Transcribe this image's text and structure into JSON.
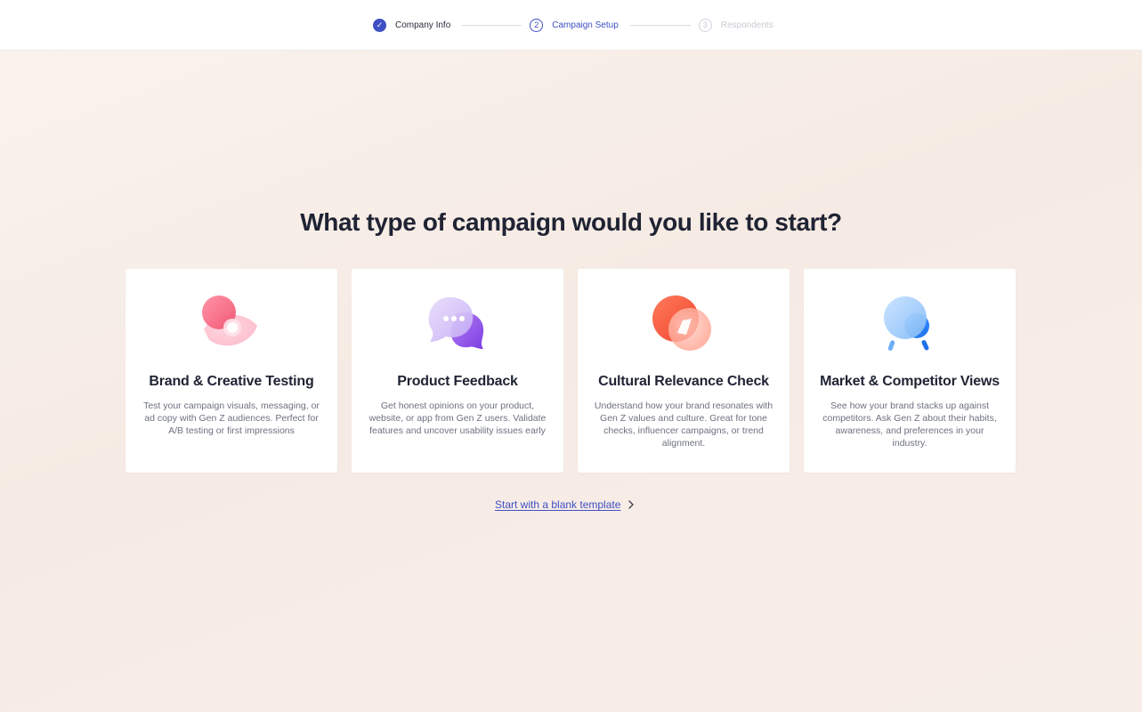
{
  "stepper": {
    "steps": [
      {
        "number": "✓",
        "label": "Company Info",
        "state": "done"
      },
      {
        "number": "2",
        "label": "Campaign Setup",
        "state": "active"
      },
      {
        "number": "3",
        "label": "Respondents",
        "state": "pending"
      }
    ]
  },
  "main": {
    "headline": "What type of campaign would you like to start?",
    "cards": [
      {
        "title": "Brand & Creative Testing",
        "description": "Test your campaign visuals, messaging, or ad copy with Gen Z audiences. Perfect for A/B testing or first impressions",
        "icon": "eye-icon"
      },
      {
        "title": "Product Feedback",
        "description": "Get honest opinions on your product, website, or app from Gen Z users. Validate features and uncover usability issues early",
        "icon": "chat-bubble-icon"
      },
      {
        "title": "Cultural Relevance Check",
        "description": "Understand how your brand resonates with Gen Z values and culture. Great for tone checks, influencer campaigns, or trend alignment.",
        "icon": "compass-icon"
      },
      {
        "title": "Market & Competitor Views",
        "description": "See how your brand stacks up against competitors. Ask Gen Z about their habits, awareness, and preferences in your industry.",
        "icon": "binoculars-icon"
      }
    ],
    "blank_template_link": "Start with a blank template"
  },
  "colors": {
    "accent": "#3f4fc4",
    "background": "#f7ede7",
    "card": "#ffffff",
    "heading": "#1f2333",
    "body_text": "#6d7180"
  }
}
